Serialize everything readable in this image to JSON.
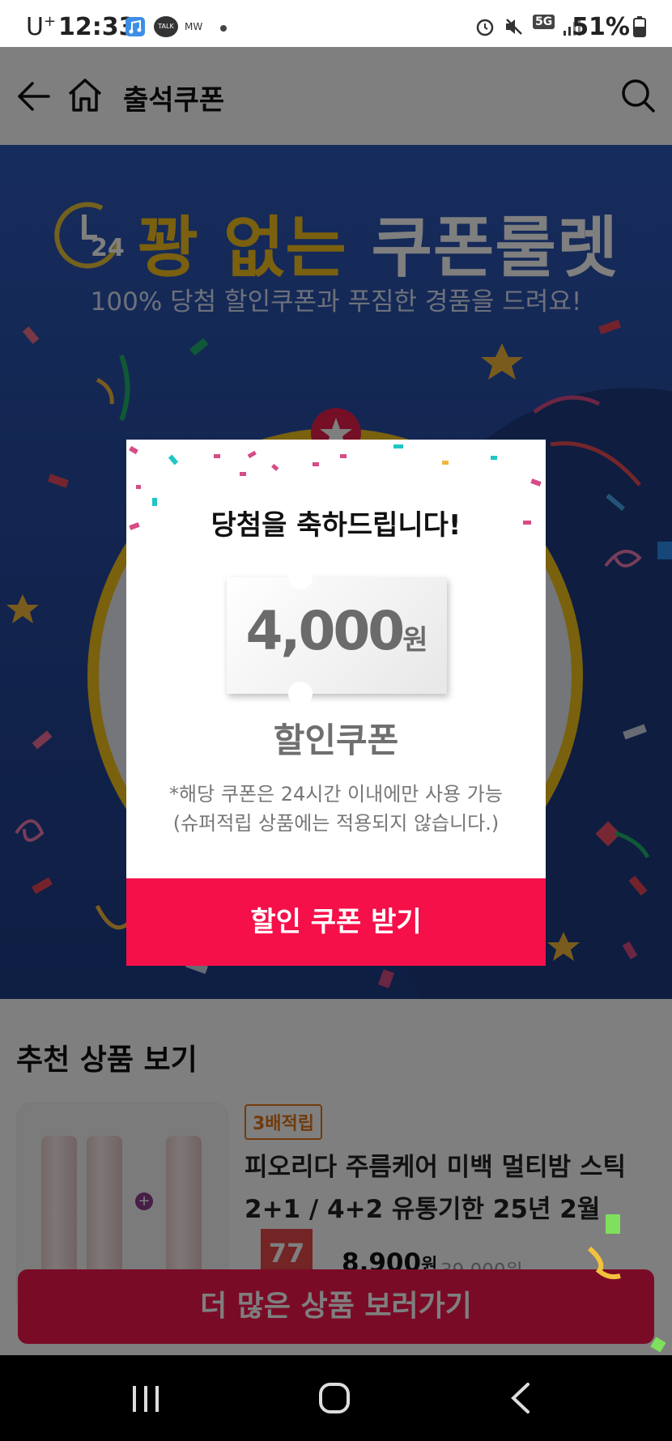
{
  "status_bar": {
    "carrier": "U",
    "carrier_sup": "+",
    "time": "12:33",
    "talk_label": "TALK",
    "mw_label": "MW",
    "network": "5G",
    "battery": "51%"
  },
  "header": {
    "title": "출석쿠폰",
    "back_icon": "arrow-left-icon",
    "home_icon": "home-icon",
    "search_icon": "search-icon"
  },
  "banner": {
    "clock_label": "24",
    "title_part1": "꽝 없는",
    "title_part2": "쿠폰룰렛",
    "subtitle": "100% 당첨 할인쿠폰과 푸짐한 경품을 드려요!"
  },
  "modal": {
    "congrats": "당첨을 축하드립니다!",
    "amount": "4,000",
    "amount_unit": "원",
    "coupon_type": "할인쿠폰",
    "note_line1": "*해당 쿠폰은 24시간 이내에만 사용 가능",
    "note_line2": "(슈퍼적립 상품에는 적용되지 않습니다.)",
    "cta": "할인 쿠폰 받기"
  },
  "recommendations": {
    "heading": "추천 상품 보기",
    "product": {
      "badge": "3배적립",
      "name": "피오리다 주름케어 미백 멀티밤 스틱 2+1 / 4+2 유통기한 25년 2월",
      "discount": "77",
      "price": "8,900",
      "price_unit": "원",
      "old_price": "39,000원"
    }
  },
  "more_button": "더 많은 상품 보러가기",
  "nav": {
    "recents_icon": "recents-icon",
    "home_icon": "home-circle-icon",
    "back_icon": "back-chevron-icon"
  },
  "colors": {
    "banner_blue": "#2d59b8",
    "gold": "#f4c01e",
    "cta_red": "#f5104a",
    "more_btn": "#f5164c"
  }
}
